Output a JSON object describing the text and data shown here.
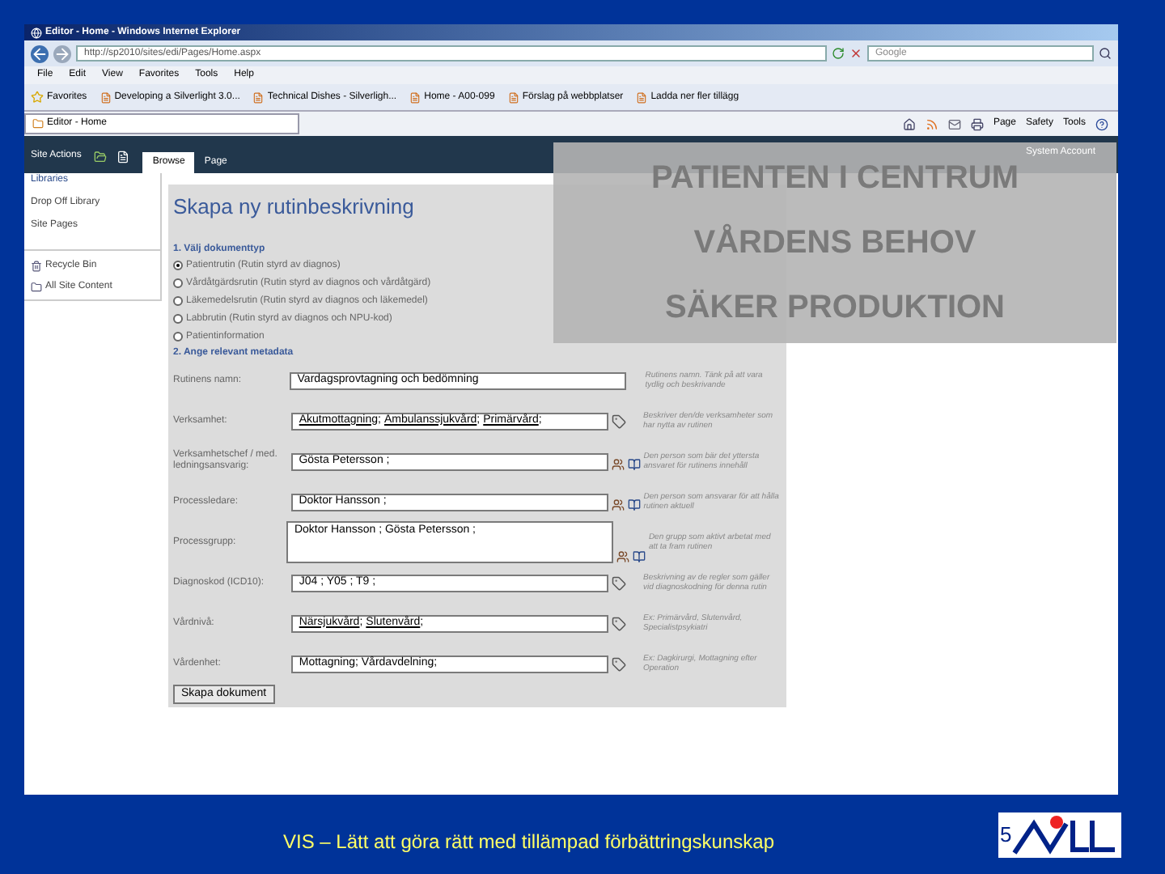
{
  "browser": {
    "title": "Editor - Home - Windows Internet Explorer",
    "address": "http://sp2010/sites/edi/Pages/Home.aspx",
    "search_placeholder": "Google",
    "menu": [
      "File",
      "Edit",
      "View",
      "Favorites",
      "Tools",
      "Help"
    ],
    "favorites_label": "Favorites",
    "favorites": [
      "Developing a Silverlight 3.0...",
      "Technical Dishes - Silverligh...",
      "Home - A00-099",
      "Förslag på webbplatser",
      "Ladda ner fler tillägg"
    ],
    "tab": "Editor - Home",
    "commands": [
      "Page",
      "Safety",
      "Tools"
    ]
  },
  "ribbon": {
    "site_actions": "Site Actions",
    "tabs": [
      {
        "label": "Browse",
        "selected": true
      },
      {
        "label": "Page",
        "selected": false
      }
    ],
    "account": "System Account"
  },
  "nav": {
    "items": [
      {
        "label": "Libraries",
        "kind": "heading"
      },
      {
        "label": "Drop Off Library",
        "kind": "link"
      },
      {
        "label": "Site Pages",
        "kind": "link"
      }
    ],
    "tools": [
      {
        "label": "Recycle Bin",
        "kind": "bin"
      },
      {
        "label": "All Site Content",
        "kind": "content"
      }
    ]
  },
  "form": {
    "title": "Skapa ny rutinbeskrivning",
    "section_1": "1. Välj dokumenttyp",
    "doc_types": [
      {
        "label": "Patientrutin (Rutin styrd av diagnos)",
        "selected": true
      },
      {
        "label": "Vårdåtgärdsrutin (Rutin styrd av diagnos och vårdåtgärd)",
        "selected": false
      },
      {
        "label": "Läkemedelsrutin (Rutin styrd av diagnos och läkemedel)",
        "selected": false
      },
      {
        "label": "Labbrutin (Rutin styrd av diagnos och NPU-kod)",
        "selected": false
      },
      {
        "label": "Patientinformation",
        "selected": false
      }
    ],
    "section_2": "2. Ange relevant metadata",
    "fields": [
      {
        "kind": "text",
        "label": "Rutinens namn:",
        "value": "Vardagsprovtagning och bedömning",
        "help": "Rutinens namn. Tänk på att vara tydlig och beskrivande"
      },
      {
        "kind": "terms",
        "label": "Verksamhet:",
        "links": [
          "Akutmottagning",
          "Ambulanssjukvård",
          "Primärvård"
        ],
        "separator": ";",
        "help": "Beskriver den/de verksamheter som har nytta av rutinen"
      },
      {
        "kind": "people",
        "label": "Verksamhetschef / med. ledningsansvarig:",
        "value": "Gösta Petersson ;",
        "help": "Den person som bär det yttersta ansvaret för rutinens innehåll"
      },
      {
        "kind": "people",
        "label": "Processledare:",
        "value": "Doktor Hansson ;",
        "help": "Den person som ansvarar för att hålla rutinen aktuell"
      },
      {
        "kind": "people_area",
        "label": "Processgrupp:",
        "value": "Doktor Hansson ; Gösta Petersson ;",
        "help": "Den grupp som aktivt arbetat med att ta fram rutinen"
      },
      {
        "kind": "terms",
        "label": "Diagnoskod (ICD10):",
        "value": "J04 ; Y05 ; T9 ;",
        "help": "Beskrivning av de regler som gäller vid diagnoskodning för denna rutin"
      },
      {
        "kind": "terms",
        "label": "Vårdnivå:",
        "links": [
          "Närsjukvård",
          "Slutenvård"
        ],
        "separator": ";",
        "help": "Ex: Primärvård, Slutenvård, Specialistpsykiatri"
      },
      {
        "kind": "terms",
        "label": "Vårdenhet:",
        "value": "Mottagning; Vårdavdelning;",
        "help": "Ex: Dagkirurgi, Mottagning efter Operation"
      }
    ],
    "button": "Skapa dokument"
  },
  "overlay": {
    "headings": [
      "PATIENTEN I CENTRUM",
      "VÅRDENS BEHOV",
      "SÄKER PRODUKTION"
    ]
  },
  "footer": {
    "text": "VIS – Lätt att göra rätt med tillämpad förbättringskunskap",
    "slide_number": "5"
  }
}
